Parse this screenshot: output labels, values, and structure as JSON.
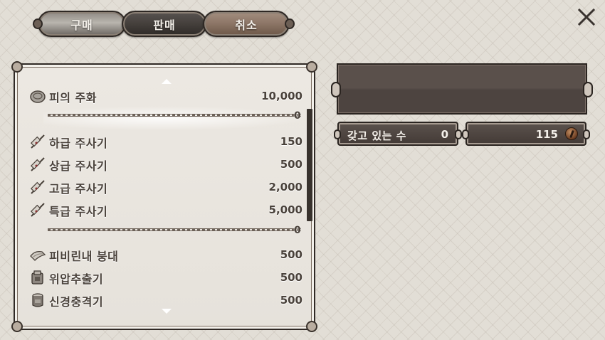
{
  "tabs": {
    "buy": "구매",
    "sell": "판매",
    "cancel": "취소"
  },
  "close_icon": "close-x-icon",
  "list": {
    "rows": [
      {
        "name": "피의 주화",
        "price": "10,000",
        "icon": "blood-coin-icon"
      },
      {
        "name": "하급 주사기",
        "price": "150",
        "icon": "syringe-icon"
      },
      {
        "name": "상급 주사기",
        "price": "500",
        "icon": "syringe-icon"
      },
      {
        "name": "고급 주사기",
        "price": "2,000",
        "icon": "syringe-icon"
      },
      {
        "name": "특급 주사기",
        "price": "5,000",
        "icon": "syringe-icon"
      },
      {
        "name": "피비린내 붕대",
        "price": "500",
        "icon": "bandage-icon"
      },
      {
        "name": "위압추출기",
        "price": "500",
        "icon": "extractor-icon"
      },
      {
        "name": "신경충격기",
        "price": "500",
        "icon": "nerve-shocker-icon"
      }
    ],
    "dividers": [
      {
        "count": "0"
      },
      {
        "count": "0"
      }
    ]
  },
  "owned": {
    "label": "갖고 있는 수",
    "value": "0"
  },
  "money": {
    "value": "115",
    "icon": "blood-echo-coin-icon"
  },
  "colors": {
    "panel_dark": "#4d4440",
    "tab_cancel": "#8c7566",
    "text_dark": "#4a423b"
  }
}
